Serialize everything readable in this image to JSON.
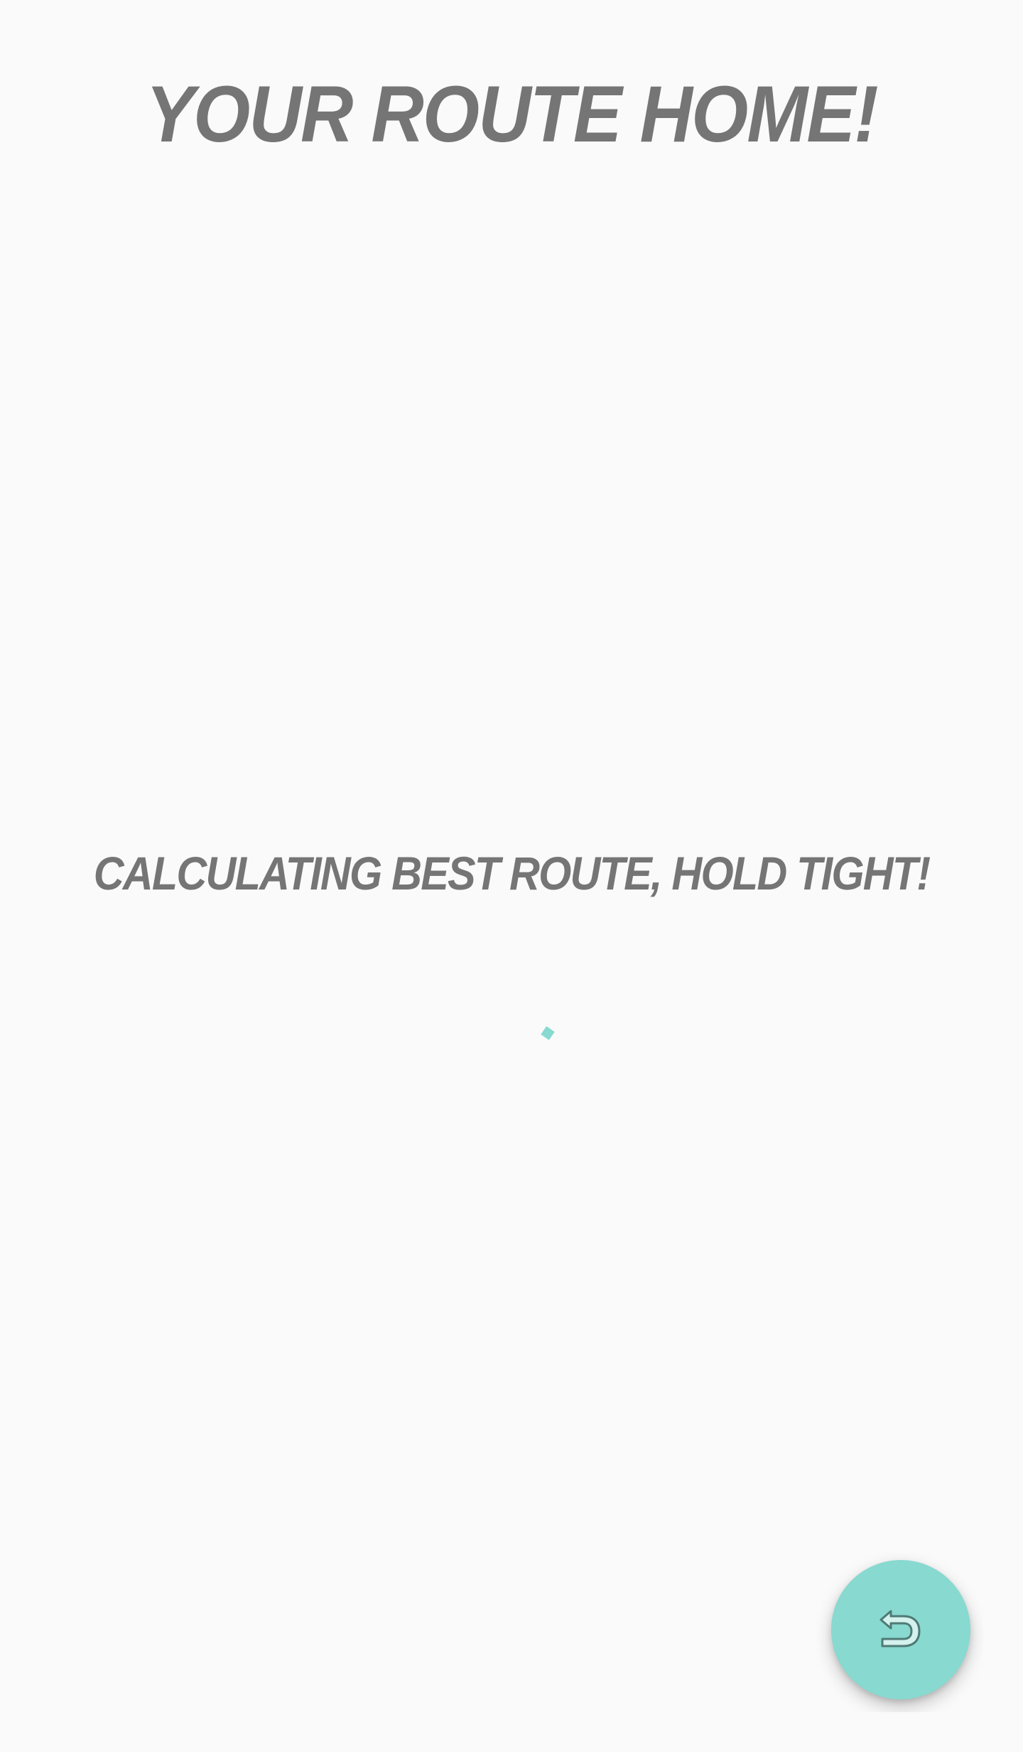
{
  "header": {
    "title": "Your Route Home!"
  },
  "status": {
    "message": "Calculating best route, hold tight!"
  },
  "spinner": {
    "icon": "loading-spinner",
    "color": "#88d9d0"
  },
  "fab": {
    "icon": "undo-arrow-icon",
    "color": "#88d9d0"
  }
}
